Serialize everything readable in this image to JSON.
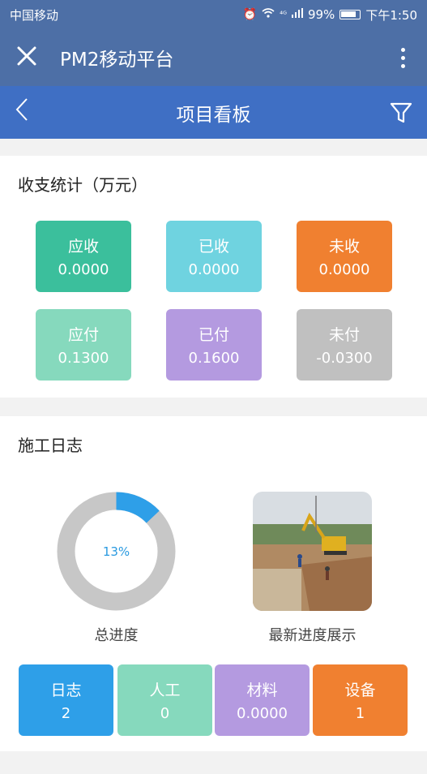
{
  "status": {
    "carrier": "中国移动",
    "network": "⁴ᴳ",
    "battery": "99%",
    "time": "下午1:50"
  },
  "appbar": {
    "title": "PM2移动平台"
  },
  "navbar": {
    "title": "项目看板"
  },
  "income": {
    "title": "收支统计（万元）",
    "tiles": [
      {
        "label": "应收",
        "value": "0.0000",
        "color": "#3bbf9c"
      },
      {
        "label": "已收",
        "value": "0.0000",
        "color": "#6fd3e0"
      },
      {
        "label": "未收",
        "value": "0.0000",
        "color": "#f08030"
      },
      {
        "label": "应付",
        "value": "0.1300",
        "color": "#86d9bd"
      },
      {
        "label": "已付",
        "value": "0.1600",
        "color": "#b49ae0"
      },
      {
        "label": "未付",
        "value": "-0.0300",
        "color": "#c0c0c0"
      }
    ]
  },
  "log": {
    "title": "施工日志",
    "progress": {
      "percent": 13,
      "label": "13%",
      "caption": "总进度",
      "track_color": "#c7c7c7",
      "fill_color": "#2e9fe8"
    },
    "photo_caption": "最新进度展示",
    "stats": [
      {
        "label": "日志",
        "value": "2",
        "color": "#2e9fe8"
      },
      {
        "label": "人工",
        "value": "0",
        "color": "#86d9bd"
      },
      {
        "label": "材料",
        "value": "0.0000",
        "color": "#b49ae0"
      },
      {
        "label": "设备",
        "value": "1",
        "color": "#f08030"
      }
    ]
  }
}
